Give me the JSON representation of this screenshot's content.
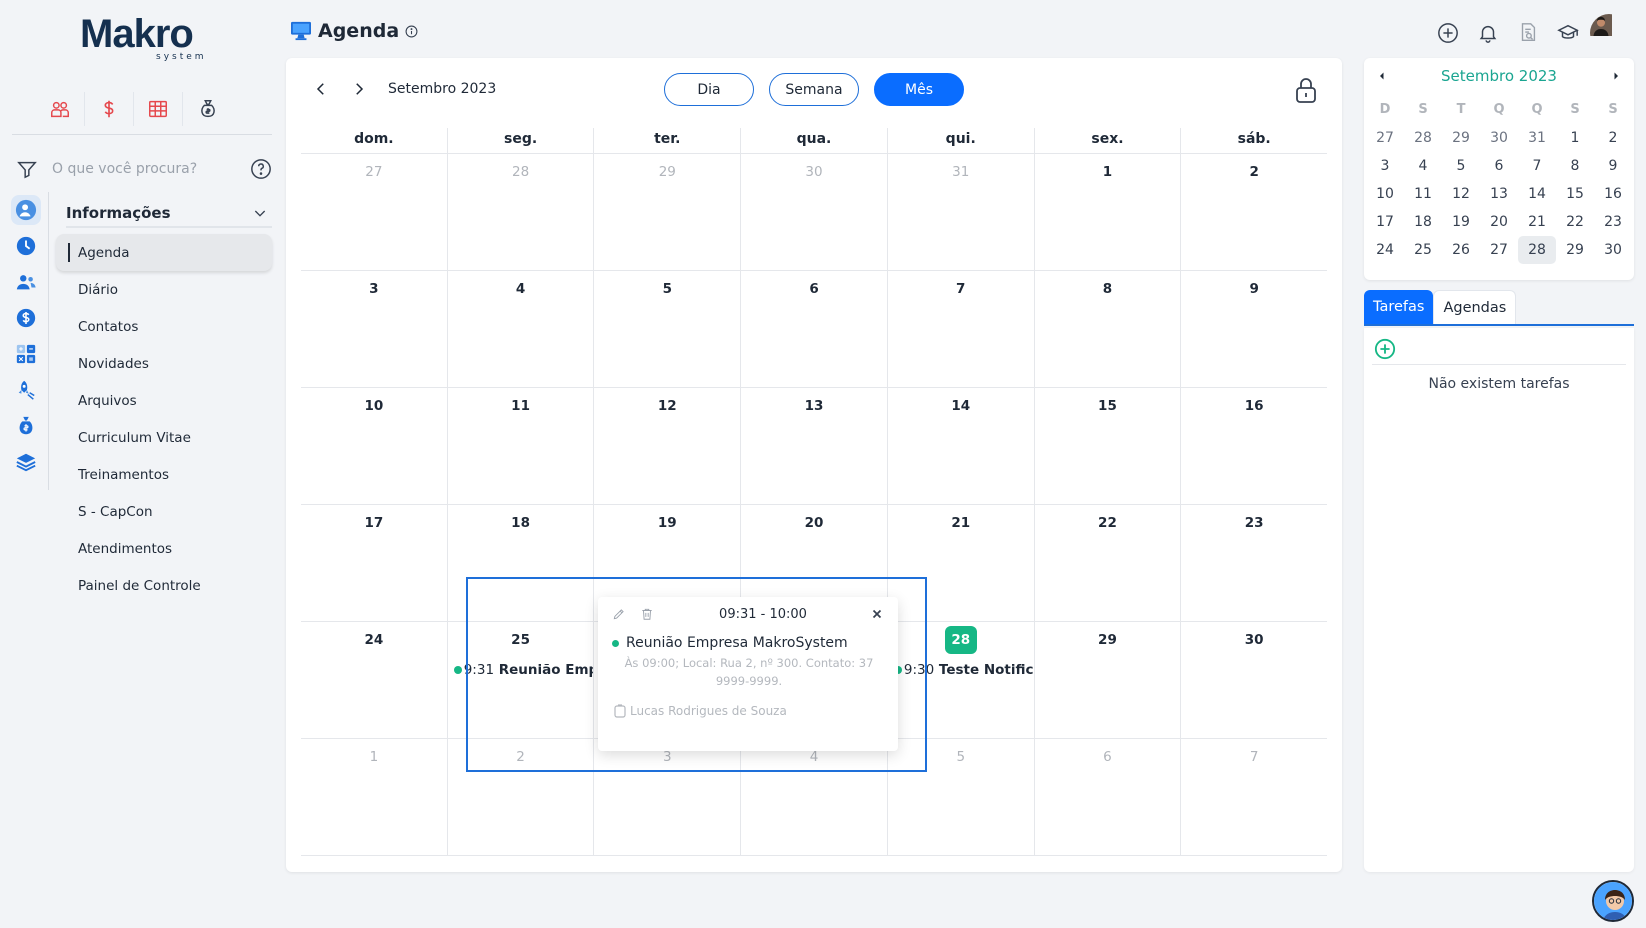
{
  "brand": {
    "logo_main": "Makro",
    "logo_sub": "system"
  },
  "colors": {
    "accent": "#0a6dff",
    "teal": "#1aa591",
    "green": "#16b785",
    "red": "#e5484d"
  },
  "quick_icons": [
    "people-icon",
    "dollar-icon",
    "table-icon",
    "money-bag-icon"
  ],
  "sidebar": {
    "search_placeholder": "O que você procura?",
    "section_title": "Informações",
    "rail_icons": [
      "user-info-icon",
      "clock-icon",
      "users-icon",
      "dollar-circle-icon",
      "calculator-icon",
      "rocket-icon",
      "money-bag-icon",
      "layers-icon"
    ],
    "items": [
      {
        "label": "Agenda",
        "active": true
      },
      {
        "label": "Diário"
      },
      {
        "label": "Contatos"
      },
      {
        "label": "Novidades"
      },
      {
        "label": "Arquivos"
      },
      {
        "label": "Curriculum Vitae"
      },
      {
        "label": "Treinamentos"
      },
      {
        "label": "S - CapCon"
      },
      {
        "label": "Atendimentos"
      },
      {
        "label": "Painel de Controle"
      }
    ]
  },
  "header": {
    "title": "Agenda"
  },
  "calendar": {
    "month_label": "Setembro 2023",
    "views": {
      "day": "Dia",
      "week": "Semana",
      "month": "Mês"
    },
    "active_view": "Mês",
    "weekdays": [
      "dom.",
      "seg.",
      "ter.",
      "qua.",
      "qui.",
      "sex.",
      "sáb."
    ],
    "weeks": [
      [
        {
          "d": "27",
          "m": true
        },
        {
          "d": "28",
          "m": true
        },
        {
          "d": "29",
          "m": true
        },
        {
          "d": "30",
          "m": true
        },
        {
          "d": "31",
          "m": true
        },
        {
          "d": "1"
        },
        {
          "d": "2"
        }
      ],
      [
        {
          "d": "3"
        },
        {
          "d": "4"
        },
        {
          "d": "5"
        },
        {
          "d": "6"
        },
        {
          "d": "7"
        },
        {
          "d": "8"
        },
        {
          "d": "9"
        }
      ],
      [
        {
          "d": "10"
        },
        {
          "d": "11"
        },
        {
          "d": "12"
        },
        {
          "d": "13"
        },
        {
          "d": "14"
        },
        {
          "d": "15"
        },
        {
          "d": "16"
        }
      ],
      [
        {
          "d": "17"
        },
        {
          "d": "18"
        },
        {
          "d": "19"
        },
        {
          "d": "20"
        },
        {
          "d": "21"
        },
        {
          "d": "22"
        },
        {
          "d": "23"
        }
      ],
      [
        {
          "d": "24"
        },
        {
          "d": "25",
          "event": {
            "time": "9:31",
            "title": "Reunião Empr"
          }
        },
        {
          "d": ""
        },
        {
          "d": ""
        },
        {
          "d": "28",
          "today": true,
          "event": {
            "time": "9:30",
            "title": "Teste Notificc"
          }
        },
        {
          "d": "29"
        },
        {
          "d": "30"
        }
      ],
      [
        {
          "d": "1",
          "m": true
        },
        {
          "d": "2",
          "m": true
        },
        {
          "d": "3",
          "m": true
        },
        {
          "d": "4",
          "m": true
        },
        {
          "d": "5",
          "m": true
        },
        {
          "d": "6",
          "m": true
        },
        {
          "d": "7",
          "m": true
        }
      ]
    ]
  },
  "popover": {
    "time": "09:31 - 10:00",
    "title": "Reunião Empresa MakroSystem",
    "description": "Às 09:00; Local: Rua 2, nº 300. Contato: 37 9999-9999.",
    "user": "Lucas Rodrigues de Souza"
  },
  "mini_calendar": {
    "month_label": "Setembro 2023",
    "dow": [
      "D",
      "S",
      "T",
      "Q",
      "Q",
      "S",
      "S"
    ],
    "rows": [
      [
        {
          "d": "27",
          "m": true
        },
        {
          "d": "28",
          "m": true
        },
        {
          "d": "29",
          "m": true
        },
        {
          "d": "30",
          "m": true
        },
        {
          "d": "31",
          "m": true
        },
        {
          "d": "1"
        },
        {
          "d": "2"
        }
      ],
      [
        {
          "d": "3"
        },
        {
          "d": "4"
        },
        {
          "d": "5"
        },
        {
          "d": "6"
        },
        {
          "d": "7"
        },
        {
          "d": "8"
        },
        {
          "d": "9"
        }
      ],
      [
        {
          "d": "10"
        },
        {
          "d": "11"
        },
        {
          "d": "12"
        },
        {
          "d": "13"
        },
        {
          "d": "14"
        },
        {
          "d": "15"
        },
        {
          "d": "16"
        }
      ],
      [
        {
          "d": "17"
        },
        {
          "d": "18"
        },
        {
          "d": "19"
        },
        {
          "d": "20"
        },
        {
          "d": "21"
        },
        {
          "d": "22"
        },
        {
          "d": "23"
        }
      ],
      [
        {
          "d": "24"
        },
        {
          "d": "25"
        },
        {
          "d": "26"
        },
        {
          "d": "27"
        },
        {
          "d": "28",
          "sel": true
        },
        {
          "d": "29"
        },
        {
          "d": "30"
        }
      ]
    ]
  },
  "tasks": {
    "tab_tasks": "Tarefas",
    "tab_agendas": "Agendas",
    "empty_text": "Não existem tarefas"
  }
}
